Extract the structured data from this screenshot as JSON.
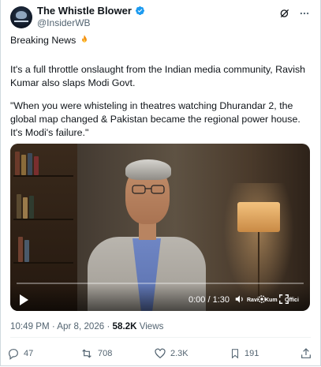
{
  "tweet": {
    "author": {
      "display_name": "The Whistle Blower",
      "handle": "@InsiderWB",
      "avatar_label": "WHISTLE BLOWER"
    },
    "paragraphs": [
      "Breaking News",
      "It's a full throttle onslaught from the Indian media community, Ravish Kumar also slaps Modi Govt.",
      "\"When you were whisteling in theatres watching Dhurandar 2, the global map changed & Pakistan became the regional power house. It's Modi's failure.\""
    ],
    "emoji": "fire",
    "video": {
      "time": "0:00 / 1:30",
      "watermark": "Ravish Kumar Official",
      "watermark_short": [
        "Ravi",
        "Kum",
        "Offici"
      ]
    },
    "meta": {
      "timestamp": "10:49 PM · Apr 8, 2026 · ",
      "views_count": "58.2K",
      "views_label": " Views"
    },
    "actions": {
      "replies": "47",
      "reposts": "708",
      "likes": "2.3K",
      "bookmarks": "191"
    }
  },
  "colors": {
    "text_primary": "#0f1419",
    "text_secondary": "#536471",
    "verified_blue": "#1d9bf0",
    "border": "#cfd9de"
  },
  "icons": [
    "grok-icon",
    "more-icon",
    "verified-badge-icon",
    "fire-emoji-icon",
    "play-icon",
    "volume-icon",
    "settings-icon",
    "fullscreen-icon",
    "reply-icon",
    "repost-icon",
    "like-icon",
    "bookmark-icon",
    "share-icon"
  ]
}
